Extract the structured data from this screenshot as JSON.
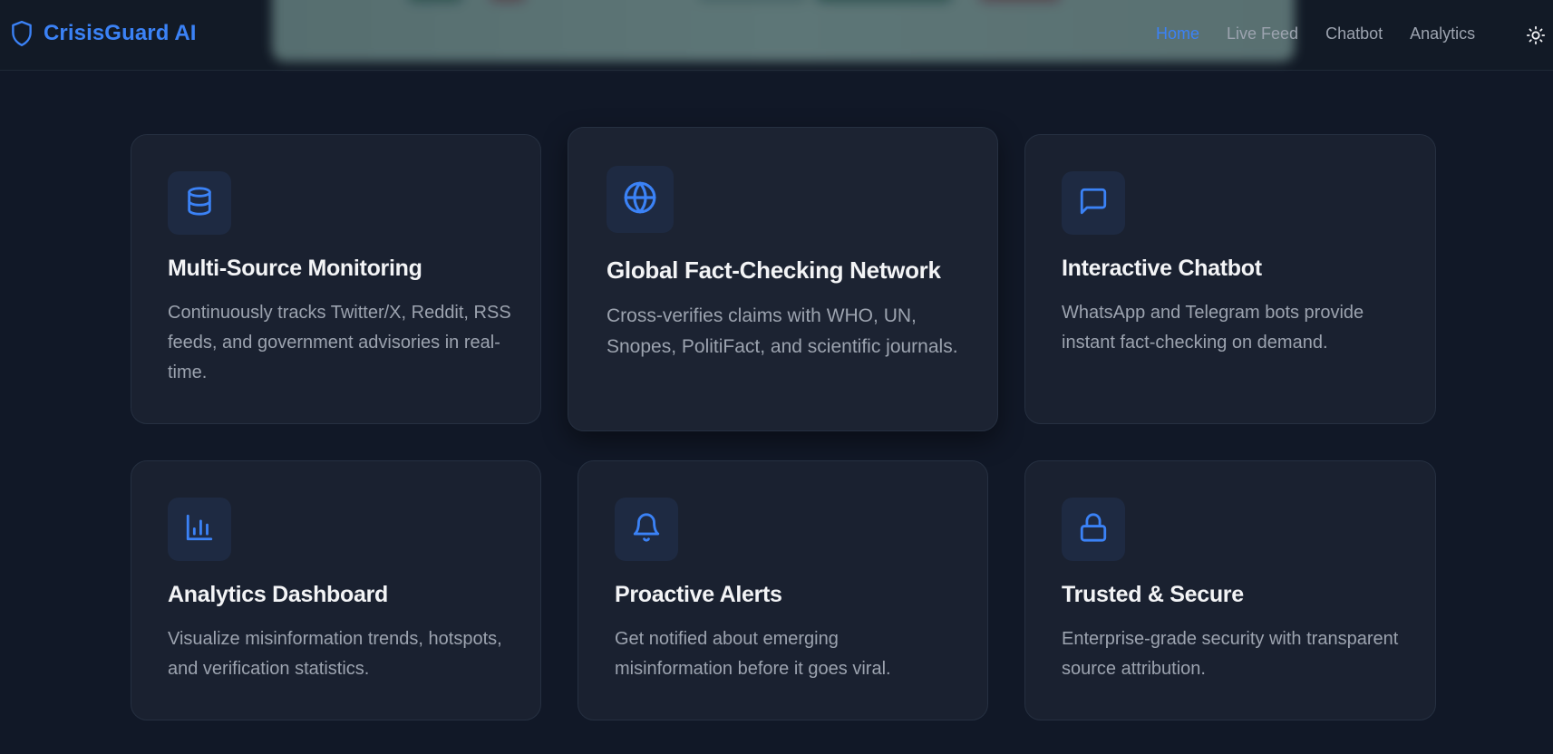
{
  "brand": {
    "name": "CrisisGuard AI",
    "icon": "shield-icon",
    "color": "#3b82f6"
  },
  "nav": {
    "links": [
      {
        "label": "Home",
        "active": true
      },
      {
        "label": "Live Feed",
        "active": false
      },
      {
        "label": "Chatbot",
        "active": false
      },
      {
        "label": "Analytics",
        "active": false
      }
    ],
    "theme_toggle_icon": "sun-icon"
  },
  "colors": {
    "background": "#111827",
    "card": "#1a2130",
    "accent": "#3b82f6",
    "title": "#f3f4f6",
    "muted": "#9ca3af"
  },
  "features": [
    {
      "icon": "database-icon",
      "title": "Multi-Source Monitoring",
      "description": "Continuously tracks Twitter/X, Reddit, RSS feeds, and government advisories in real-time."
    },
    {
      "icon": "globe-icon",
      "title": "Global Fact-Checking Network",
      "description": "Cross-verifies claims with WHO, UN, Snopes, PolitiFact, and scientific journals."
    },
    {
      "icon": "message-square-icon",
      "title": "Interactive Chatbot",
      "description": "WhatsApp and Telegram bots provide instant fact-checking on demand."
    },
    {
      "icon": "bar-chart-icon",
      "title": "Analytics Dashboard",
      "description": "Visualize misinformation trends, hotspots, and verification statistics."
    },
    {
      "icon": "bell-icon",
      "title": "Proactive Alerts",
      "description": "Get notified about emerging misinformation before it goes viral."
    },
    {
      "icon": "lock-icon",
      "title": "Trusted & Secure",
      "description": "Enterprise-grade security with transparent source attribution."
    }
  ]
}
